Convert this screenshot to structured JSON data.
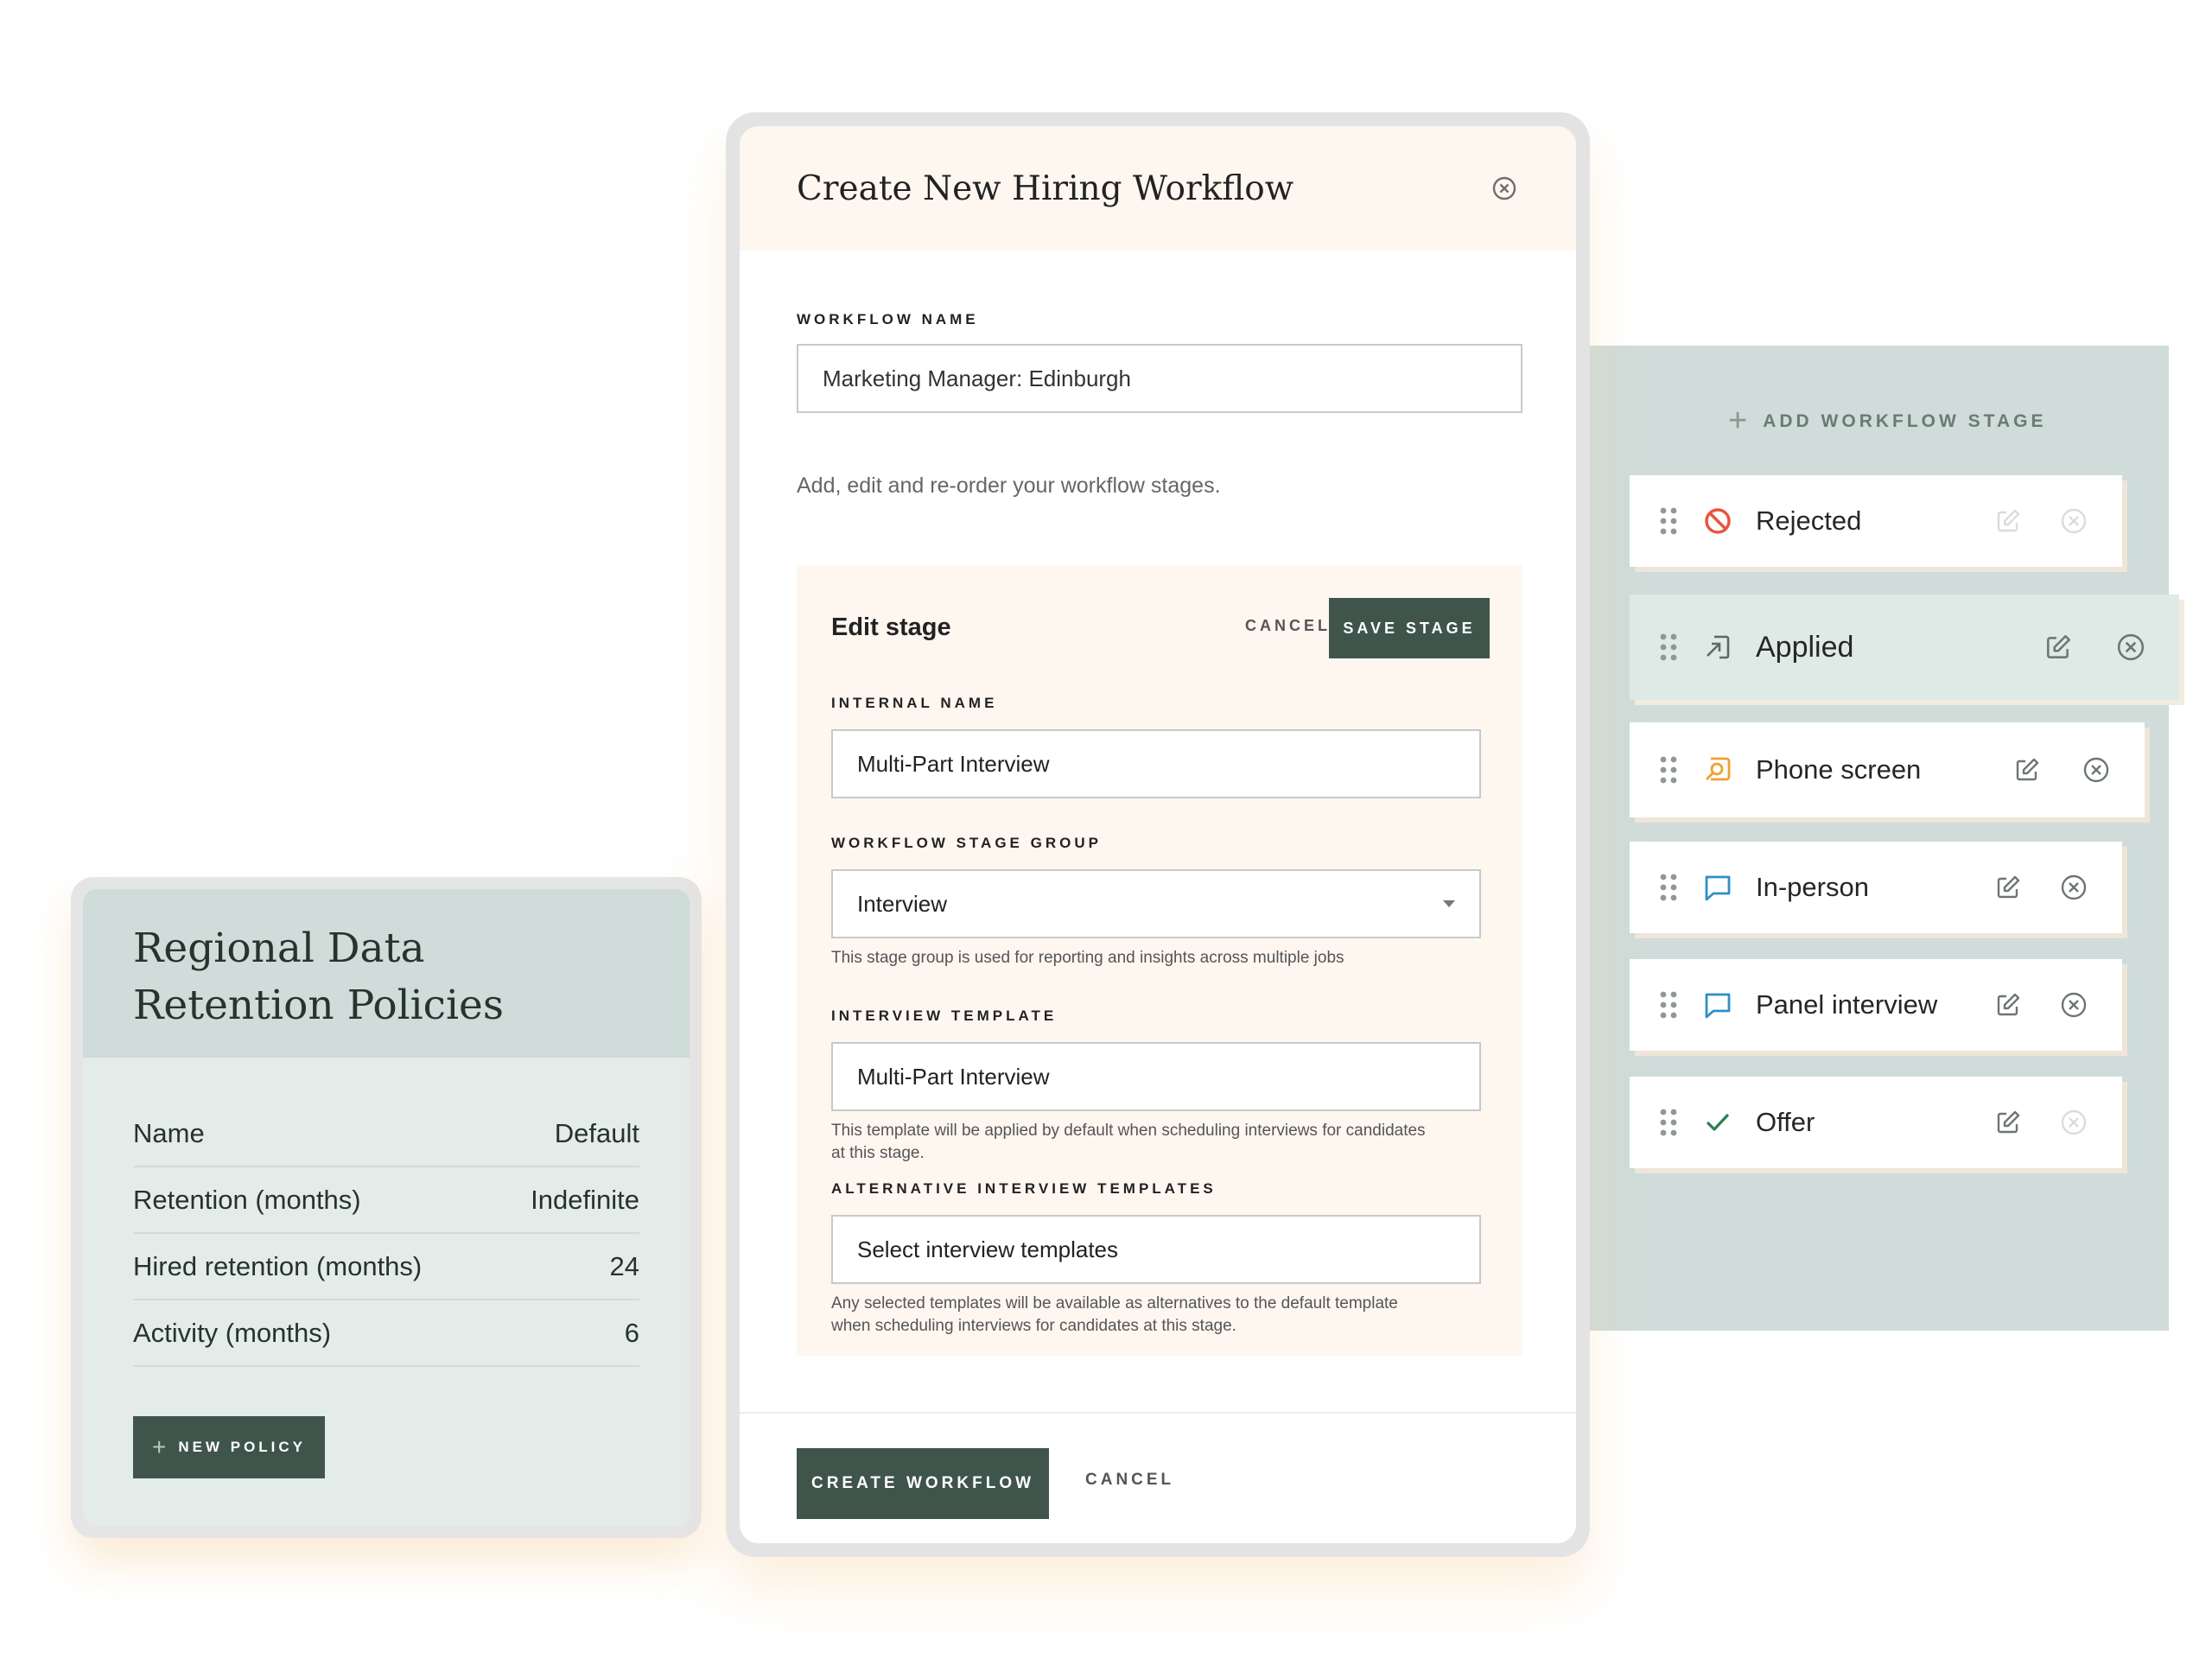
{
  "policy": {
    "title_line1": "Regional Data",
    "title_line2": "Retention Policies",
    "rows": [
      {
        "label": "Name",
        "value": "Default"
      },
      {
        "label": "Retention (months)",
        "value": "Indefinite"
      },
      {
        "label": "Hired retention (months)",
        "value": "24"
      },
      {
        "label": "Activity (months)",
        "value": "6"
      }
    ],
    "new_policy_label": "NEW POLICY"
  },
  "modal": {
    "title": "Create New Hiring Workflow",
    "workflow_name_label": "WORKFLOW NAME",
    "workflow_name_value": "Marketing Manager: Edinburgh",
    "helper_text": "Add, edit and re-order your workflow stages.",
    "edit_stage": {
      "title": "Edit stage",
      "cancel_label": "CANCEL",
      "save_label": "SAVE STAGE",
      "internal_name_label": "INTERNAL NAME",
      "internal_name_value": "Multi-Part Interview",
      "group_label": "WORKFLOW STAGE GROUP",
      "group_value": "Interview",
      "group_help": "This stage group is used for reporting and insights across multiple jobs",
      "template_label": "INTERVIEW TEMPLATE",
      "template_value": "Multi-Part Interview",
      "template_help": "This template will be applied by default when scheduling interviews for candidates at this stage.",
      "alt_label": "ALTERNATIVE INTERVIEW TEMPLATES",
      "alt_placeholder": "Select interview templates",
      "alt_help": "Any selected templates will be available as alternatives to the default template when scheduling interviews for candidates at this stage."
    },
    "create_label": "CREATE WORKFLOW",
    "footer_cancel_label": "CANCEL"
  },
  "stages_panel": {
    "add_label": "ADD WORKFLOW STAGE",
    "stages": [
      {
        "name": "Rejected",
        "icon": "prohibited-icon",
        "color": "#e8553b"
      },
      {
        "name": "Applied",
        "icon": "arrow-in-icon",
        "color": "#5a6a65"
      },
      {
        "name": "Phone screen",
        "icon": "phone-screen-icon",
        "color": "#f0a030"
      },
      {
        "name": "In-person",
        "icon": "chat-bubble-icon",
        "color": "#2f8fc4"
      },
      {
        "name": "Panel interview",
        "icon": "chat-bubble-icon",
        "color": "#2f8fc4"
      },
      {
        "name": "Offer",
        "icon": "checkmark-icon",
        "color": "#2e7d4f"
      }
    ]
  },
  "colors": {
    "accent_dark_green": "#3f554c",
    "panel_sage": "#cfdcd9",
    "cream": "#fdf7f0"
  }
}
